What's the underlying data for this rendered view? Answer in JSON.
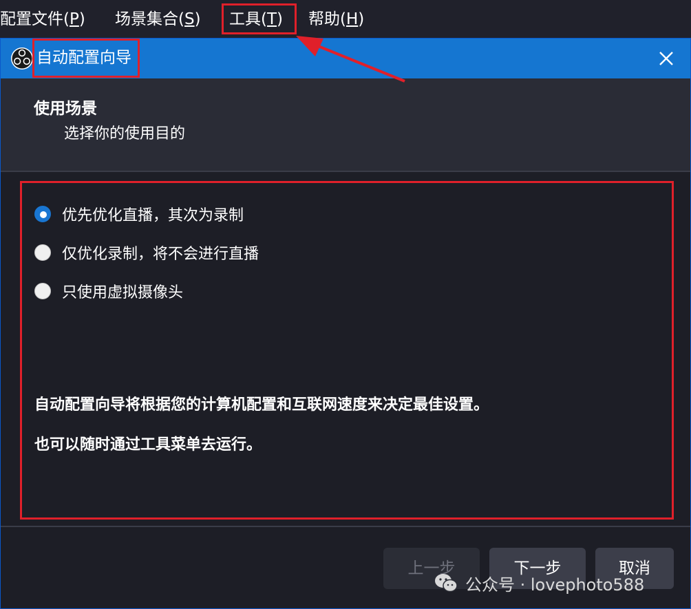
{
  "menubar": {
    "items": [
      {
        "label": "配置文件(",
        "mnemonic": "P",
        "suffix": ")"
      },
      {
        "label": "场景集合(",
        "mnemonic": "S",
        "suffix": ")"
      },
      {
        "label": "工具(",
        "mnemonic": "T",
        "suffix": ")"
      },
      {
        "label": "帮助(",
        "mnemonic": "H",
        "suffix": ")"
      }
    ]
  },
  "dialog": {
    "title": "自动配置向导",
    "close_icon": "close-icon",
    "header": {
      "title": "使用场景",
      "subtitle": "选择你的使用目的"
    },
    "options": [
      {
        "label": "优先优化直播，其次为录制",
        "checked": true
      },
      {
        "label": "仅优化录制，将不会进行直播",
        "checked": false
      },
      {
        "label": "只使用虚拟摄像头",
        "checked": false
      }
    ],
    "info_line1": "自动配置向导将根据您的计算机配置和互联网速度来决定最佳设置。",
    "info_line2": "也可以随时通过工具菜单去运行。",
    "buttons": {
      "back": "上一步",
      "next": "下一步",
      "cancel": "取消"
    }
  },
  "annotation_color": "#e0202a",
  "accent_color": "#1576d1",
  "watermark": {
    "text": "公众号 · lovephoto588"
  }
}
